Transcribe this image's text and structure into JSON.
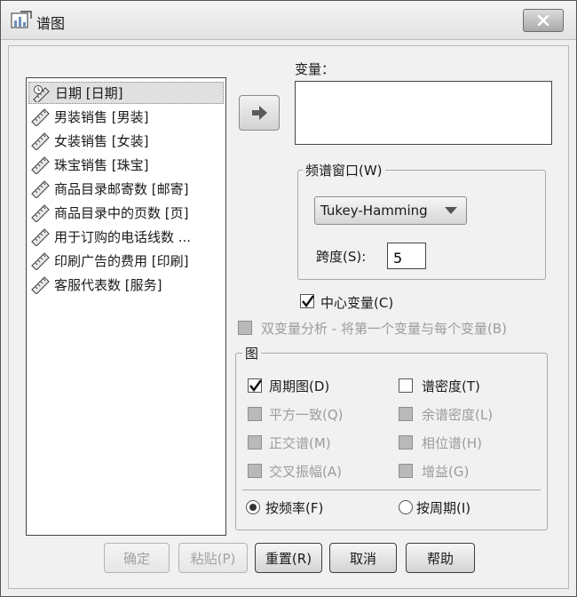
{
  "window": {
    "title": "谱图",
    "close_icon": "close-x-icon"
  },
  "variables": {
    "items": [
      {
        "label": "日期 [日期]",
        "icon": "ruler-date-icon",
        "selected": true
      },
      {
        "label": "男装销售 [男装]",
        "icon": "ruler-scale-icon",
        "selected": false
      },
      {
        "label": "女装销售 [女装]",
        "icon": "ruler-scale-icon",
        "selected": false
      },
      {
        "label": "珠宝销售 [珠宝]",
        "icon": "ruler-scale-icon",
        "selected": false
      },
      {
        "label": "商品目录邮寄数 [邮寄]",
        "icon": "ruler-scale-icon",
        "selected": false
      },
      {
        "label": "商品目录中的页数 [页]",
        "icon": "ruler-scale-icon",
        "selected": false
      },
      {
        "label": "用于订购的电话线数 ...",
        "icon": "ruler-scale-icon",
        "selected": false
      },
      {
        "label": "印刷广告的费用 [印刷]",
        "icon": "ruler-scale-icon",
        "selected": false
      },
      {
        "label": "客服代表数 [服务]",
        "icon": "ruler-scale-icon",
        "selected": false
      }
    ]
  },
  "target": {
    "label": "变量："
  },
  "spectral_window": {
    "legend": "频谱窗口(W)",
    "selected": "Tukey-Hamming",
    "span_label": "跨度(S):",
    "span_value": "5"
  },
  "center_variables": {
    "label": "中心变量(C)",
    "checked": true
  },
  "bivariate": {
    "label": "双变量分析 - 将第一个变量与每个变量(B)",
    "checked": false,
    "enabled": false
  },
  "plots": {
    "legend": "图",
    "periodogram": {
      "label": "周期图(D)",
      "checked": true
    },
    "spectral_density": {
      "label": "谱密度(T)",
      "checked": false
    },
    "squared_coherency": {
      "label": "平方一致(Q)",
      "enabled": false
    },
    "cospectral_density": {
      "label": "余谱密度(L)",
      "enabled": false
    },
    "quadrature_spectrum": {
      "label": "正交谱(M)",
      "enabled": false
    },
    "phase_spectrum": {
      "label": "相位谱(H)",
      "enabled": false
    },
    "cross_amplitude": {
      "label": "交叉振幅(A)",
      "enabled": false
    },
    "gain": {
      "label": "增益(G)",
      "enabled": false
    },
    "by_frequency": {
      "label": "按频率(F)",
      "selected": true
    },
    "by_period": {
      "label": "按周期(I)",
      "selected": false
    }
  },
  "buttons": {
    "ok": "确定",
    "paste": "粘贴(P)",
    "reset": "重置(R)",
    "cancel": "取消",
    "help": "帮助"
  }
}
